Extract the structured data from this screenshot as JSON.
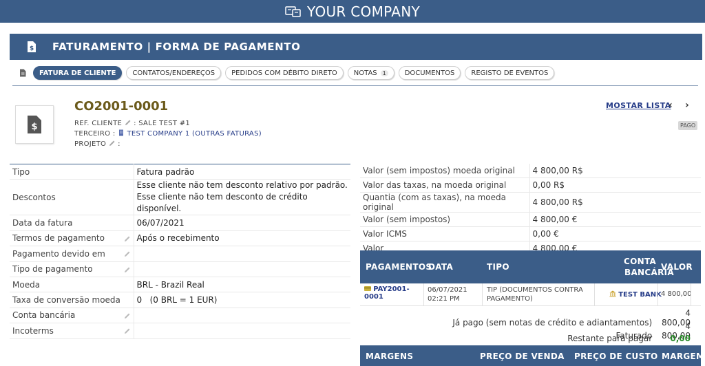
{
  "header": {
    "company": "YOUR COMPANY"
  },
  "title": "FATURAMENTO | FORMA DE PAGAMENTO",
  "tabs": [
    {
      "label": "FATURA DE CLIENTE",
      "active": true
    },
    {
      "label": "CONTATOS/ENDEREÇOS"
    },
    {
      "label": "PEDIDOS COM DÉBITO DIRETO"
    },
    {
      "label": "NOTAS",
      "badge": "1"
    },
    {
      "label": "DOCUMENTOS"
    },
    {
      "label": "REGISTO DE EVENTOS"
    }
  ],
  "invoice": {
    "ref": "CO2001-0001",
    "ref_cliente_label": "REF. CLIENTE",
    "ref_cliente_value": ": SALE TEST #1",
    "terceiro_label": "TERCEIRO :",
    "terceiro_value": "TEST COMPANY 1 (OUTRAS FATURAS)",
    "projeto_label": "PROJETO",
    "projeto_value": ":",
    "list_link": "MOSTAR LISTA",
    "status": "PAGO"
  },
  "left_fields": {
    "tipo": {
      "label": "Tipo",
      "value": "Fatura padrão"
    },
    "descontos": {
      "label": "Descontos",
      "value1": "Esse cliente não tem desconto relativo por padrão.",
      "value2": "Esse cliente não tem desconto de crédito disponível."
    },
    "data": {
      "label": "Data da fatura",
      "value": "06/07/2021"
    },
    "termos": {
      "label": "Termos de pagamento",
      "value": "Após o recebimento"
    },
    "devido": {
      "label": "Pagamento devido em",
      "value": ""
    },
    "tipo_pag": {
      "label": "Tipo de pagamento",
      "value": ""
    },
    "moeda": {
      "label": "Moeda",
      "value": "BRL - Brazil Real"
    },
    "taxa": {
      "label": "Taxa de conversão moeda",
      "value": "0   (0 BRL = 1 EUR)"
    },
    "conta": {
      "label": "Conta bancária",
      "value": ""
    },
    "incoterms": {
      "label": "Incoterms",
      "value": ""
    }
  },
  "right_fields": [
    {
      "label": "Valor (sem impostos) moeda original",
      "value": "4 800,00 R$"
    },
    {
      "label": "Valor das taxas, na moeda original",
      "value": "0,00 R$"
    },
    {
      "label": "Quantia (com as taxas), na moeda original",
      "value": "4 800,00 R$"
    },
    {
      "label": "Valor (sem impostos)",
      "value": "4 800,00 €"
    },
    {
      "label": "Valor ICMS",
      "value": "0,00 €"
    },
    {
      "label": "Valor",
      "value": "4 800,00 €"
    }
  ],
  "payments": {
    "headers": {
      "pagamentos": "PAGAMENTOS",
      "data": "DATA",
      "tipo": "TIPO",
      "conta1": "CONTA",
      "conta2": "BANCÁRIA",
      "valor": "VALOR"
    },
    "row": {
      "ref1": "PAY2001-",
      "ref2": "0001",
      "date1": "06/07/2021",
      "date2": "02:21 PM",
      "tipo1": "TIP (DOCUMENTOS CONTRA",
      "tipo2": "PAGAMENTO)",
      "conta": "TEST BANK",
      "valor": "4 800,00"
    },
    "ja_pago_label": "Já pago (sem notas de crédito e adiantamentos)",
    "ja_pago_value": "4 800,00",
    "faturado_label": "Faturado",
    "faturado_value": "4 800,00",
    "restante_label": "Restante para pagar",
    "restante_value": "0,00"
  },
  "margins": {
    "margens": "MARGENS",
    "preco_venda": "PREÇO DE VENDA",
    "preco_custo": "PREÇO DE CUSTO",
    "margem": "MARGEM"
  },
  "colors": {
    "primary": "#3b5d88",
    "link": "#263c88",
    "ref": "#6b5a1b",
    "positive": "#2a8a2a"
  }
}
